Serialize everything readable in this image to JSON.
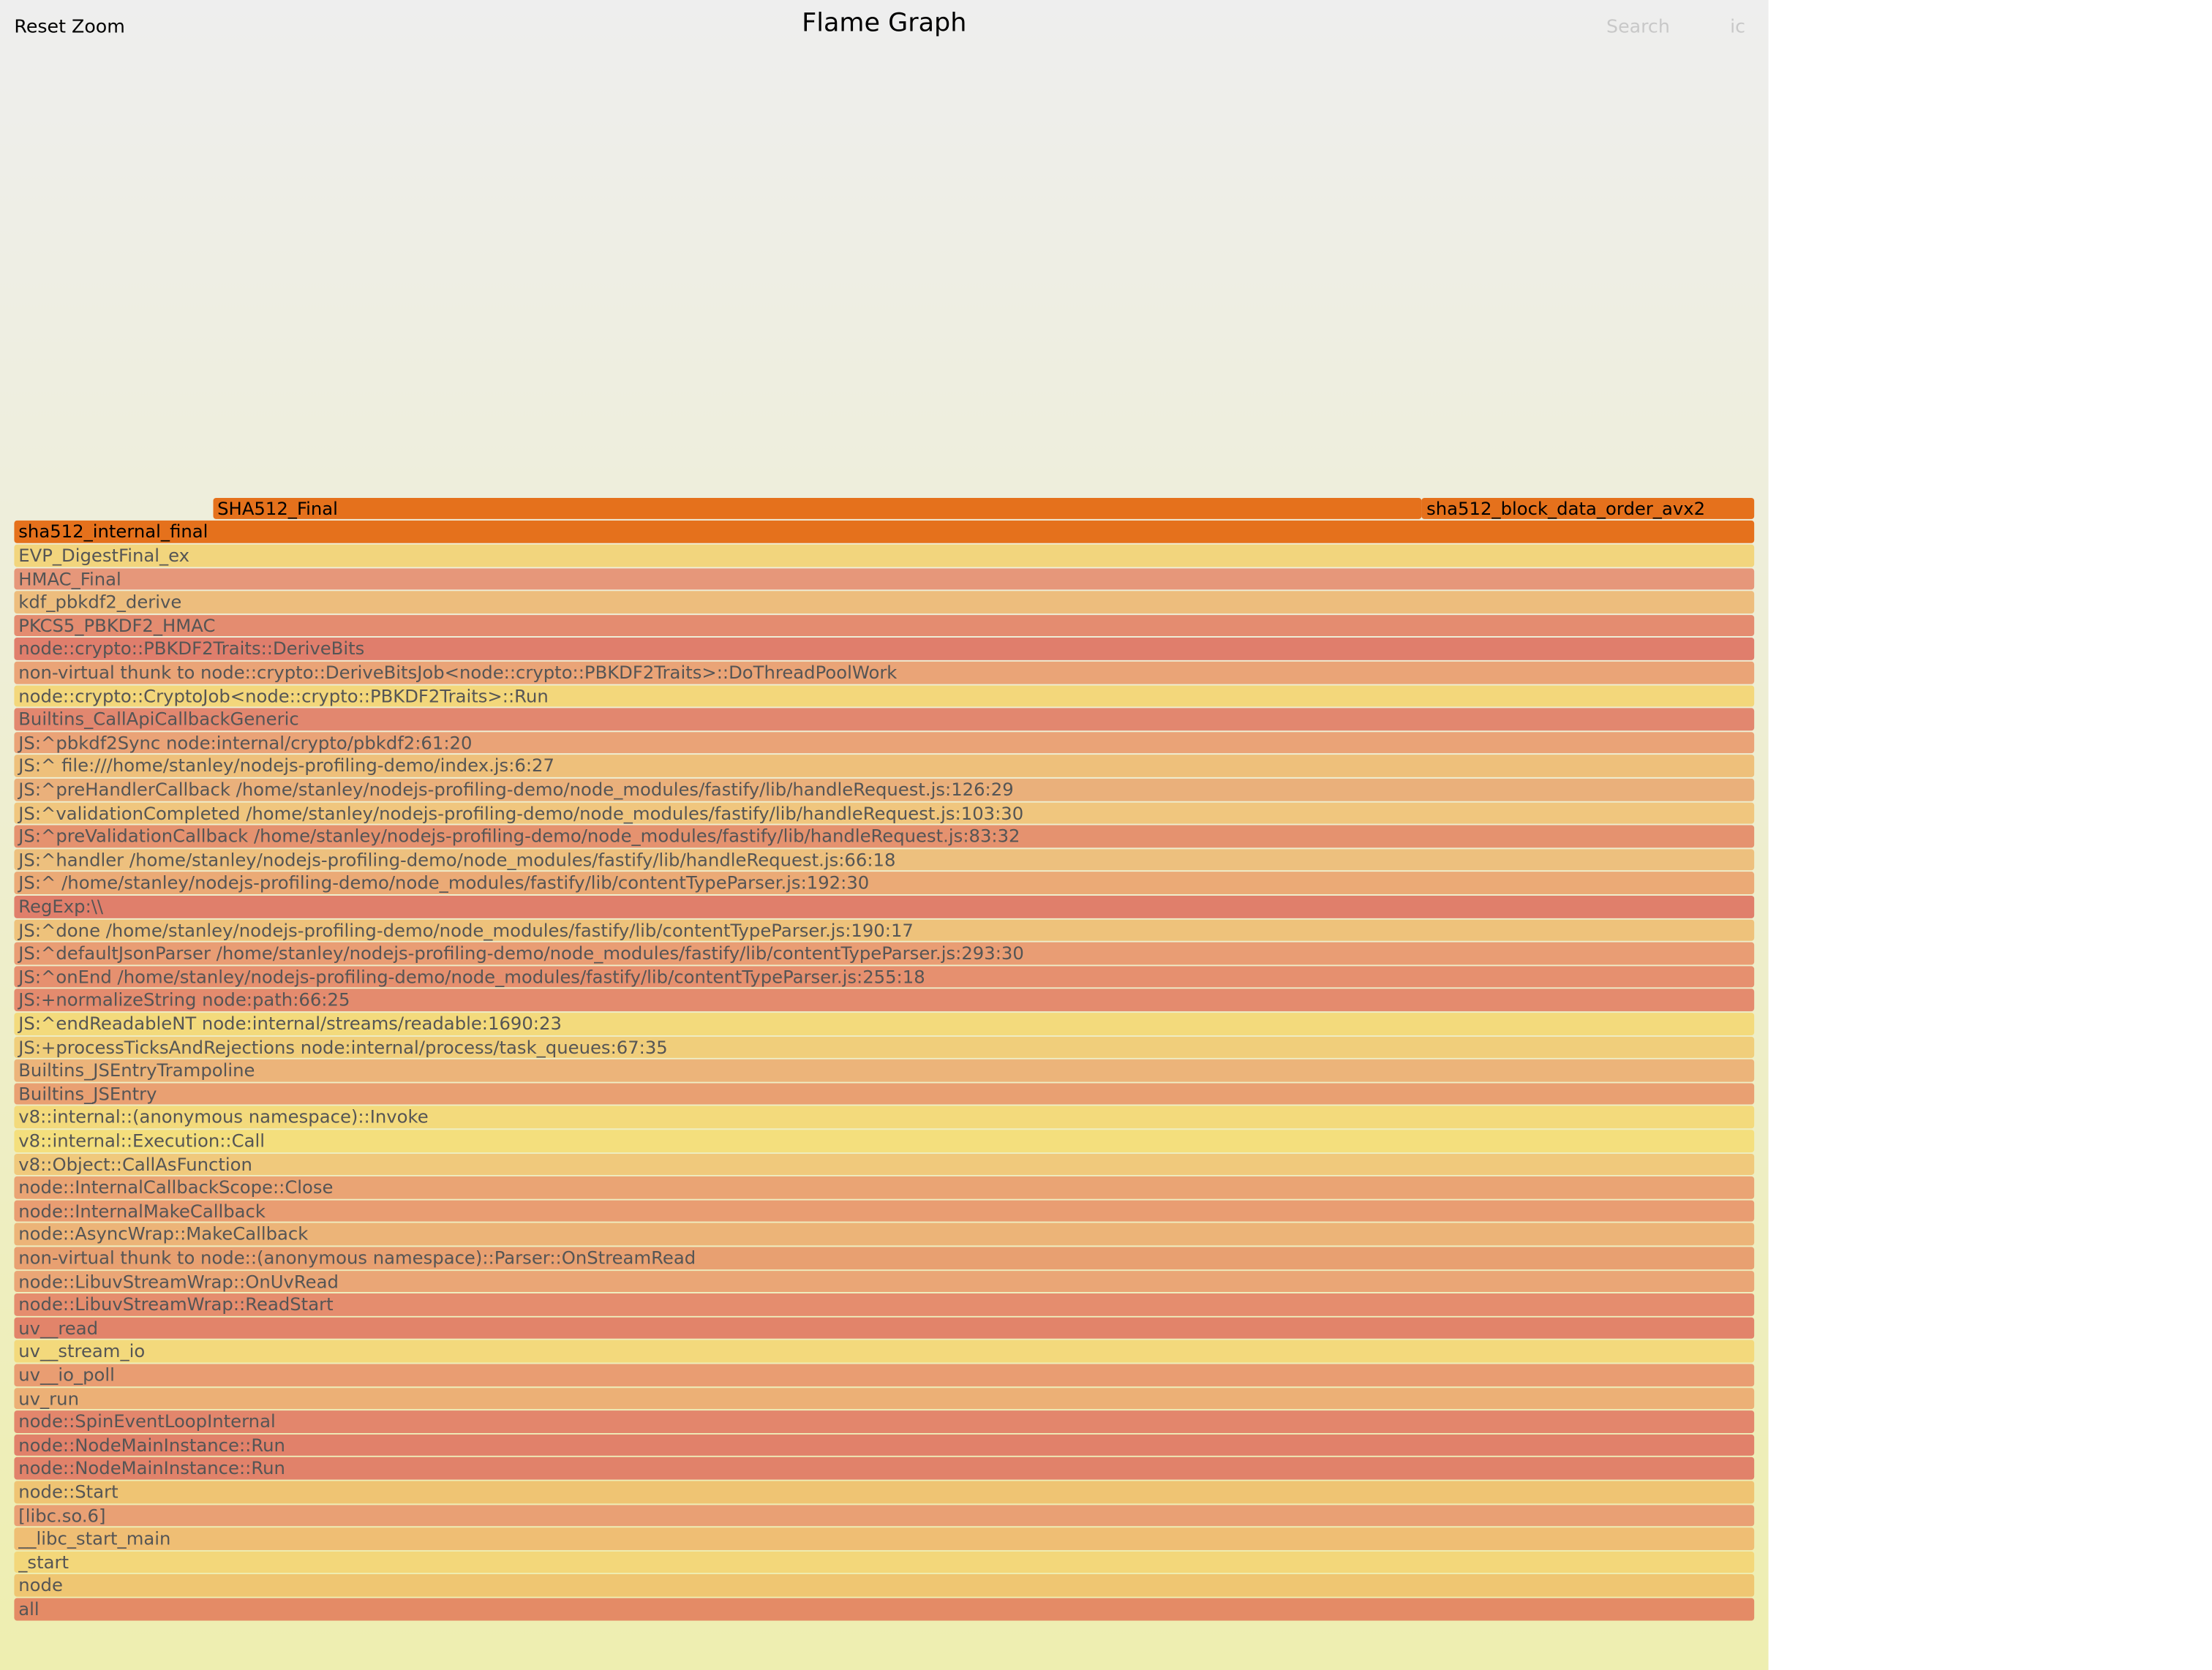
{
  "header": {
    "reset_zoom_label": "Reset Zoom",
    "title": "Flame Graph",
    "search_label": "Search",
    "ic_label": "ic"
  },
  "background": {
    "top": "#eeeeee",
    "bottom": "#eeeeb0"
  },
  "frames": [
    {
      "depth": 47,
      "label": "SHA512_Final",
      "offset": 0.1143,
      "share": 0.6949,
      "color": "#e5711c",
      "hot": true
    },
    {
      "depth": 47,
      "label": "sha512_block_data_order_avx2",
      "offset": 0.8092,
      "share": 0.1908,
      "color": "#e5711c",
      "hot": true
    },
    {
      "depth": 46,
      "label": "sha512_internal_final",
      "offset": 0,
      "share": 1,
      "color": "#e5711c",
      "hot": true
    },
    {
      "depth": 45,
      "label": "EVP_DigestFinal_ex",
      "offset": 0,
      "share": 1,
      "color": "#f2d57d"
    },
    {
      "depth": 44,
      "label": "HMAC_Final",
      "offset": 0,
      "share": 1,
      "color": "#e6977a"
    },
    {
      "depth": 43,
      "label": "kdf_pbkdf2_derive",
      "offset": 0,
      "share": 1,
      "color": "#edbd7d"
    },
    {
      "depth": 42,
      "label": "PKCS5_PBKDF2_HMAC",
      "offset": 0,
      "share": 1,
      "color": "#e48c70"
    },
    {
      "depth": 41,
      "label": "node::crypto::PBKDF2Traits::DeriveBits",
      "offset": 0,
      "share": 1,
      "color": "#e07e6c"
    },
    {
      "depth": 40,
      "label": "non-virtual thunk to node::crypto::DeriveBitsJob<node::crypto::PBKDF2Traits>::DoThreadPoolWork",
      "offset": 0,
      "share": 1,
      "color": "#eaa477"
    },
    {
      "depth": 39,
      "label": "node::crypto::CryptoJob<node::crypto::PBKDF2Traits>::Run",
      "offset": 0,
      "share": 1,
      "color": "#f3d77b"
    },
    {
      "depth": 38,
      "label": "Builtins_CallApiCallbackGeneric",
      "offset": 0,
      "share": 1,
      "color": "#e2876f"
    },
    {
      "depth": 37,
      "label": "JS:^pbkdf2Sync node:internal/crypto/pbkdf2:61:20",
      "offset": 0,
      "share": 1,
      "color": "#eaa377"
    },
    {
      "depth": 36,
      "label": "JS:^ file:///home/stanley/nodejs-profiling-demo/index.js:6:27",
      "offset": 0,
      "share": 1,
      "color": "#eec07b"
    },
    {
      "depth": 35,
      "label": "JS:^preHandlerCallback /home/stanley/nodejs-profiling-demo/node_modules/fastify/lib/handleRequest.js:126:29",
      "offset": 0,
      "share": 1,
      "color": "#eab07b"
    },
    {
      "depth": 34,
      "label": "JS:^validationCompleted /home/stanley/nodejs-profiling-demo/node_modules/fastify/lib/handleRequest.js:103:30",
      "offset": 0,
      "share": 1,
      "color": "#f0c67e"
    },
    {
      "depth": 33,
      "label": "JS:^preValidationCallback /home/stanley/nodejs-profiling-demo/node_modules/fastify/lib/handleRequest.js:83:32",
      "offset": 0,
      "share": 1,
      "color": "#e5926f"
    },
    {
      "depth": 32,
      "label": "JS:^handler /home/stanley/nodejs-profiling-demo/node_modules/fastify/lib/handleRequest.js:66:18",
      "offset": 0,
      "share": 1,
      "color": "#edc07e"
    },
    {
      "depth": 31,
      "label": "JS:^ /home/stanley/nodejs-profiling-demo/node_modules/fastify/lib/contentTypeParser.js:192:30",
      "offset": 0,
      "share": 1,
      "color": "#ebaa76"
    },
    {
      "depth": 30,
      "label": "RegExp:\\\\",
      "offset": 0,
      "share": 1,
      "color": "#e07f6b"
    },
    {
      "depth": 29,
      "label": "JS:^done /home/stanley/nodejs-profiling-demo/node_modules/fastify/lib/contentTypeParser.js:190:17",
      "offset": 0,
      "share": 1,
      "color": "#eec27b"
    },
    {
      "depth": 28,
      "label": "JS:^defaultJsonParser /home/stanley/nodejs-profiling-demo/node_modules/fastify/lib/contentTypeParser.js:293:30",
      "offset": 0,
      "share": 1,
      "color": "#e99d74"
    },
    {
      "depth": 27,
      "label": "JS:^onEnd /home/stanley/nodejs-profiling-demo/node_modules/fastify/lib/contentTypeParser.js:255:18",
      "offset": 0,
      "share": 1,
      "color": "#e6906f"
    },
    {
      "depth": 26,
      "label": "JS:+normalizeString node:path:66:25",
      "offset": 0,
      "share": 1,
      "color": "#e48b6e"
    },
    {
      "depth": 25,
      "label": "JS:^endReadableNT node:internal/streams/readable:1690:23",
      "offset": 0,
      "share": 1,
      "color": "#f3da7c"
    },
    {
      "depth": 24,
      "label": "JS:+processTicksAndRejections node:internal/process/task_queues:67:35",
      "offset": 0,
      "share": 1,
      "color": "#f0ce7b"
    },
    {
      "depth": 23,
      "label": "Builtins_JSEntryTrampoline",
      "offset": 0,
      "share": 1,
      "color": "#ecb47a"
    },
    {
      "depth": 22,
      "label": "Builtins_JSEntry",
      "offset": 0,
      "share": 1,
      "color": "#e9a072"
    },
    {
      "depth": 21,
      "label": "v8::internal::(anonymous namespace)::Invoke",
      "offset": 0,
      "share": 1,
      "color": "#f3da7c"
    },
    {
      "depth": 20,
      "label": "v8::internal::Execution::Call",
      "offset": 0,
      "share": 1,
      "color": "#f4df7d"
    },
    {
      "depth": 19,
      "label": "v8::Object::CallAsFunction",
      "offset": 0,
      "share": 1,
      "color": "#f0c97c"
    },
    {
      "depth": 18,
      "label": "node::InternalCallbackScope::Close",
      "offset": 0,
      "share": 1,
      "color": "#eaa474"
    },
    {
      "depth": 17,
      "label": "node::InternalMakeCallback",
      "offset": 0,
      "share": 1,
      "color": "#e99d72"
    },
    {
      "depth": 16,
      "label": "node::AsyncWrap::MakeCallback",
      "offset": 0,
      "share": 1,
      "color": "#ecb478"
    },
    {
      "depth": 15,
      "label": "non-virtual thunk to node::(anonymous namespace)::Parser::OnStreamRead",
      "offset": 0,
      "share": 1,
      "color": "#e8a071"
    },
    {
      "depth": 14,
      "label": "node::LibuvStreamWrap::OnUvRead",
      "offset": 0,
      "share": 1,
      "color": "#eaa676"
    },
    {
      "depth": 13,
      "label": "node::LibuvStreamWrap::ReadStart",
      "offset": 0,
      "share": 1,
      "color": "#e58d6e"
    },
    {
      "depth": 12,
      "label": "uv__read",
      "offset": 0,
      "share": 1,
      "color": "#e2846a"
    },
    {
      "depth": 11,
      "label": "uv__stream_io",
      "offset": 0,
      "share": 1,
      "color": "#f3d97c"
    },
    {
      "depth": 10,
      "label": "uv__io_poll",
      "offset": 0,
      "share": 1,
      "color": "#e99d72"
    },
    {
      "depth": 9,
      "label": "uv_run",
      "offset": 0,
      "share": 1,
      "color": "#ecb076"
    },
    {
      "depth": 8,
      "label": "node::SpinEventLoopInternal",
      "offset": 0,
      "share": 1,
      "color": "#e3866c"
    },
    {
      "depth": 7,
      "label": "node::NodeMainInstance::Run",
      "offset": 0,
      "share": 1,
      "color": "#e1816a"
    },
    {
      "depth": 6,
      "label": "node::NodeMainInstance::Run",
      "offset": 0,
      "share": 1,
      "color": "#e1826a"
    },
    {
      "depth": 5,
      "label": "node::Start",
      "offset": 0,
      "share": 1,
      "color": "#efc473"
    },
    {
      "depth": 4,
      "label": "[libc.so.6]",
      "offset": 0,
      "share": 1,
      "color": "#e9a074"
    },
    {
      "depth": 3,
      "label": "__libc_start_main",
      "offset": 0,
      "share": 1,
      "color": "#efbe74"
    },
    {
      "depth": 2,
      "label": "_start",
      "offset": 0,
      "share": 1,
      "color": "#f3d77a"
    },
    {
      "depth": 1,
      "label": "node",
      "offset": 0,
      "share": 1,
      "color": "#efc672"
    },
    {
      "depth": 0,
      "label": "all",
      "offset": 0,
      "share": 1,
      "color": "#e48b66"
    }
  ]
}
